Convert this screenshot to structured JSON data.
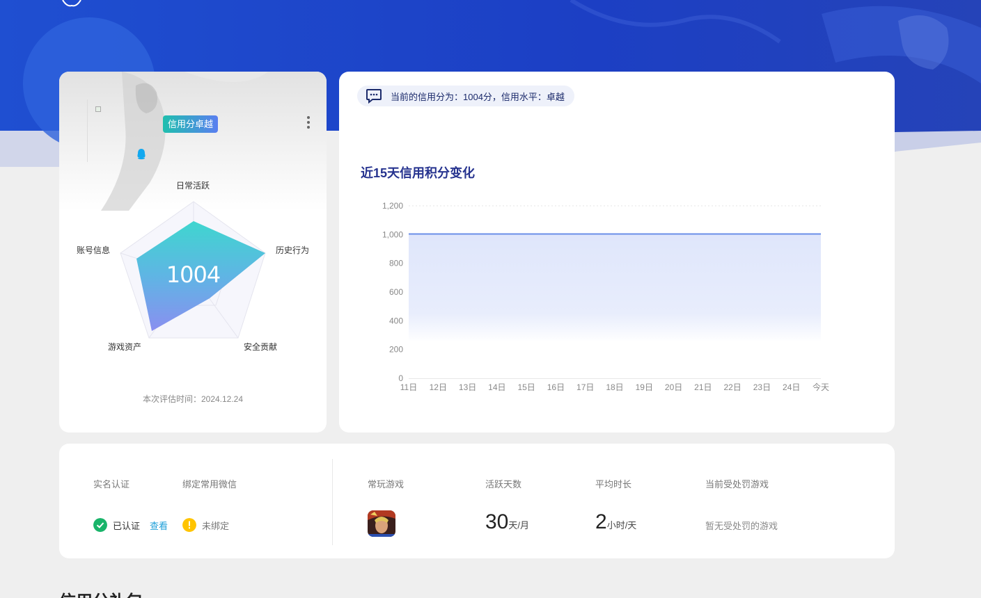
{
  "profile": {
    "badge": "信用分卓越",
    "score": "1004",
    "radar_axes": [
      "日常活跃",
      "历史行为",
      "安全贡献",
      "游戏资产",
      "账号信息"
    ],
    "eval_time": "本次评估时间：2024.12.24"
  },
  "notice": {
    "text": "当前的信用分为：1004分，信用水平：卓越"
  },
  "chart_title": "近15天信用积分变化",
  "chart_data": {
    "type": "area",
    "x": [
      "11日",
      "12日",
      "13日",
      "14日",
      "15日",
      "16日",
      "17日",
      "18日",
      "19日",
      "20日",
      "21日",
      "22日",
      "23日",
      "24日",
      "今天"
    ],
    "values": [
      1004,
      1004,
      1004,
      1004,
      1004,
      1004,
      1004,
      1004,
      1004,
      1004,
      1004,
      1004,
      1004,
      1004,
      1004
    ],
    "yticks": [
      "0",
      "200",
      "400",
      "600",
      "800",
      "1,000",
      "1,200"
    ],
    "ylim": [
      0,
      1200
    ],
    "color": "#6a8ee8"
  },
  "info": {
    "realname_label": "实名认证",
    "wechat_label": "绑定常用微信",
    "realname_status": "已认证",
    "view_link": "查看",
    "wechat_status": "未绑定",
    "games_label": "常玩游戏",
    "active_days_label": "活跃天数",
    "active_days_value": "30",
    "active_days_unit": "天/月",
    "avg_time_label": "平均时长",
    "avg_time_value": "2",
    "avg_time_unit": "小时/天",
    "penalty_label": "当前受处罚游戏",
    "penalty_value": "暂无受处罚的游戏"
  },
  "section_title": "信用分礼包"
}
